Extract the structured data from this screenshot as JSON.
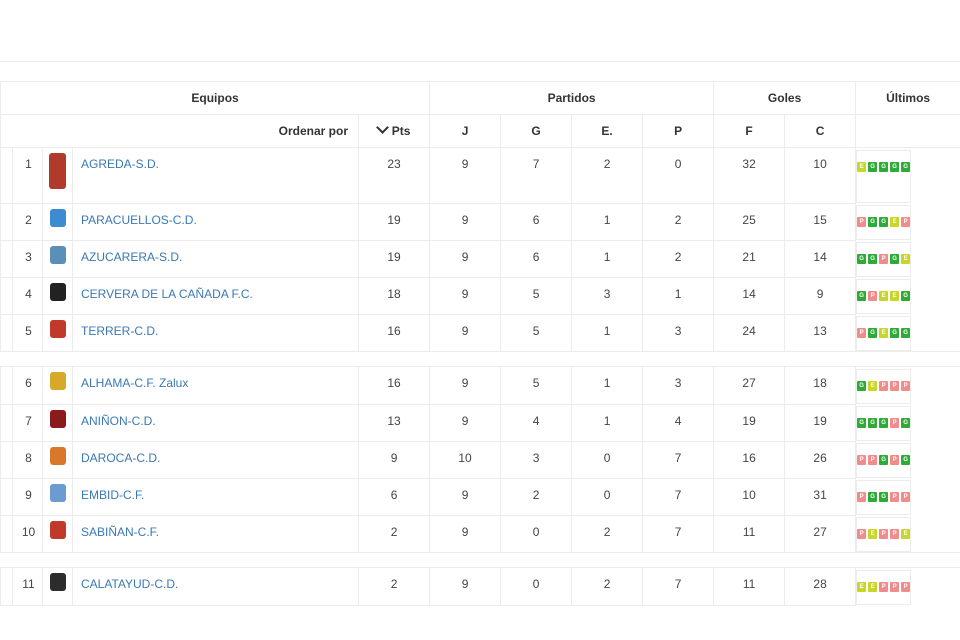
{
  "headers": {
    "equipos": "Equipos",
    "partidos": "Partidos",
    "goles": "Goles",
    "ultimos": "Últimos",
    "ordenar": "Ordenar por",
    "pts": "Pts",
    "j": "J",
    "g": "G",
    "e": "E.",
    "p": "P",
    "f": "F",
    "c": "C"
  },
  "colors": {
    "G": "#2eaa36",
    "E": "#c8d62a",
    "P": "#f08c8c",
    "link": "#3a78b5"
  },
  "groups": [
    [
      {
        "pos": "1",
        "name": "AGREDA-S.D.",
        "pts": "23",
        "j": "9",
        "g": "7",
        "e": "2",
        "p": "0",
        "f": "32",
        "c": "10",
        "form": [
          "E",
          "G",
          "G",
          "G",
          "G"
        ],
        "crest_icon": "agreda-crest-icon",
        "crestColor": "#b23a2a"
      },
      {
        "pos": "2",
        "name": "PARACUELLOS-C.D.",
        "pts": "19",
        "j": "9",
        "g": "6",
        "e": "1",
        "p": "2",
        "f": "25",
        "c": "15",
        "form": [
          "P",
          "G",
          "G",
          "E",
          "P"
        ],
        "crest_icon": "paracuellos-crest-icon",
        "crestColor": "#3d8bd0"
      },
      {
        "pos": "3",
        "name": "AZUCARERA-S.D.",
        "pts": "19",
        "j": "9",
        "g": "6",
        "e": "1",
        "p": "2",
        "f": "21",
        "c": "14",
        "form": [
          "G",
          "G",
          "P",
          "G",
          "E"
        ],
        "crest_icon": "azucarera-crest-icon",
        "crestColor": "#5a8fb8"
      },
      {
        "pos": "4",
        "name": "CERVERA DE LA CAÑADA F.C.",
        "pts": "18",
        "j": "9",
        "g": "5",
        "e": "3",
        "p": "1",
        "f": "14",
        "c": "9",
        "form": [
          "G",
          "P",
          "E",
          "E",
          "G"
        ],
        "crest_icon": "cervera-crest-icon",
        "crestColor": "#222222"
      },
      {
        "pos": "5",
        "name": "TERRER-C.D.",
        "pts": "16",
        "j": "9",
        "g": "5",
        "e": "1",
        "p": "3",
        "f": "24",
        "c": "13",
        "form": [
          "P",
          "G",
          "E",
          "G",
          "G"
        ],
        "crest_icon": "terrer-crest-icon",
        "crestColor": "#c0392b"
      }
    ],
    [
      {
        "pos": "6",
        "name": "ALHAMA-C.F. Zalux",
        "pts": "16",
        "j": "9",
        "g": "5",
        "e": "1",
        "p": "3",
        "f": "27",
        "c": "18",
        "form": [
          "G",
          "E",
          "P",
          "P",
          "P"
        ],
        "crest_icon": "alhama-crest-icon",
        "crestColor": "#d6a92a"
      },
      {
        "pos": "7",
        "name": "ANIÑON-C.D.",
        "pts": "13",
        "j": "9",
        "g": "4",
        "e": "1",
        "p": "4",
        "f": "19",
        "c": "19",
        "form": [
          "G",
          "G",
          "G",
          "P",
          "G"
        ],
        "crest_icon": "aninon-crest-icon",
        "crestColor": "#8b1a1a"
      },
      {
        "pos": "8",
        "name": "DAROCA-C.D.",
        "pts": "9",
        "j": "10",
        "g": "3",
        "e": "0",
        "p": "7",
        "f": "16",
        "c": "26",
        "form": [
          "P",
          "P",
          "G",
          "P",
          "G"
        ],
        "crest_icon": "daroca-crest-icon",
        "crestColor": "#d9772b"
      },
      {
        "pos": "9",
        "name": "EMBID-C.F.",
        "pts": "6",
        "j": "9",
        "g": "2",
        "e": "0",
        "p": "7",
        "f": "10",
        "c": "31",
        "form": [
          "P",
          "G",
          "G",
          "P",
          "P"
        ],
        "crest_icon": "embid-crest-icon",
        "crestColor": "#6a9bd1"
      },
      {
        "pos": "10",
        "name": "SABIÑAN-C.F.",
        "pts": "2",
        "j": "9",
        "g": "0",
        "e": "2",
        "p": "7",
        "f": "11",
        "c": "27",
        "form": [
          "P",
          "E",
          "P",
          "P",
          "E"
        ],
        "crest_icon": "sabinan-crest-icon",
        "crestColor": "#c0392b"
      }
    ],
    [
      {
        "pos": "11",
        "name": "CALATAYUD-C.D.",
        "pts": "2",
        "j": "9",
        "g": "0",
        "e": "2",
        "p": "7",
        "f": "11",
        "c": "28",
        "form": [
          "E",
          "E",
          "P",
          "P",
          "P"
        ],
        "crest_icon": "calatayud-crest-icon",
        "crestColor": "#2c2c2c"
      }
    ]
  ]
}
